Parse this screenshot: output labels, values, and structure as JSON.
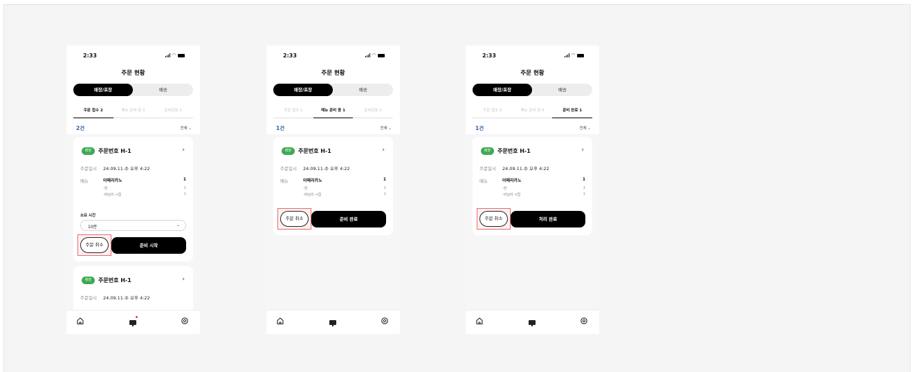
{
  "screens": [
    {
      "time": "2:33",
      "title": "주문 현황",
      "segment": {
        "on": "매장/포장",
        "off": "배송"
      },
      "tabs": [
        "주문 접수 2",
        "메뉴 준비 중 0",
        "준비완료 0"
      ],
      "active_tab": 0,
      "count": "2건",
      "filter": "전체",
      "card1": {
        "badge": "매장",
        "order_no": "주문번호 H-1",
        "date_label": "주문일시",
        "date": "24.09.11.수 오후 4:22",
        "menu_label": "메뉴",
        "menu_name": "아메리카노",
        "menu_qty": "1",
        "opt1": "-핫",
        "opt1_qty": "1",
        "opt2": "-바닐라 시럽",
        "opt2_qty": "1",
        "time_label": "소요 시간",
        "time_value": "10분",
        "cancel": "주문 취소",
        "action": "준비 시작"
      },
      "card2": {
        "badge": "매장",
        "order_no": "주문번호 H-1",
        "date_label": "주문일시",
        "date": "24.09.11.수 오후 4:22"
      }
    },
    {
      "time": "2:33",
      "title": "주문 현황",
      "segment": {
        "on": "매장/포장",
        "off": "배송"
      },
      "tabs": [
        "주문 접수 1",
        "메뉴 준비 중 1",
        "준비완료 0"
      ],
      "active_tab": 1,
      "count": "1건",
      "filter": "전체",
      "card1": {
        "badge": "매장",
        "order_no": "주문번호 H-1",
        "date_label": "주문일시",
        "date": "24.09.11.수 오후 4:22",
        "menu_label": "메뉴",
        "menu_name": "아메리카노",
        "menu_qty": "1",
        "opt1": "-핫",
        "opt1_qty": "1",
        "opt2": "-바닐라 시럽",
        "opt2_qty": "1",
        "cancel": "주문 취소",
        "action": "준비 완료"
      }
    },
    {
      "time": "2:33",
      "title": "주문 현황",
      "segment": {
        "on": "매장/포장",
        "off": "배송"
      },
      "tabs": [
        "주문 접수 0",
        "메뉴 준비 중 0",
        "준비 완료 1"
      ],
      "active_tab": 2,
      "count": "1건",
      "filter": "전체",
      "card1": {
        "badge": "매장",
        "order_no": "주문번호 H-1",
        "date_label": "주문일시",
        "date": "24.09.11.수 오후 4:22",
        "menu_label": "메뉴",
        "menu_name": "아메리카노",
        "menu_qty": "1",
        "opt1": "-핫",
        "opt1_qty": "1",
        "opt2": "-바닐라 시럽",
        "opt2_qty": "1",
        "cancel": "주문 취소",
        "action": "처리 완료"
      }
    }
  ],
  "icons": {
    "nav": [
      "home-icon",
      "monitor-icon",
      "settings-icon"
    ],
    "status": [
      "signal-icon",
      "wifi-icon",
      "battery-icon"
    ]
  },
  "colors": {
    "accent_green": "#3daa52",
    "count_blue": "#2f5f9e",
    "highlight_red": "#e56b6b",
    "primary": "#000000"
  }
}
